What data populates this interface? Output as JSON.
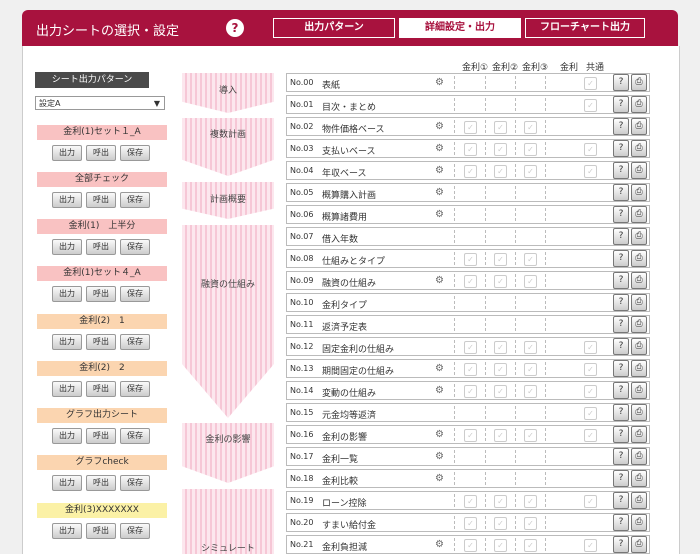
{
  "header": {
    "title": "出力シートの選択・設定",
    "help_icon": "?",
    "tabs": [
      {
        "label": "出力パターン",
        "active": false
      },
      {
        "label": "詳細設定・出力",
        "active": true
      },
      {
        "label": "フローチャート出力",
        "active": false
      }
    ]
  },
  "columns": {
    "kinri1": "金利①",
    "kinri2": "金利②",
    "kinri3": "金利③",
    "kinri": "金利",
    "kyotsu": "共通"
  },
  "left": {
    "title": "シート出力パターン",
    "select_value": "設定A",
    "button_labels": {
      "out": "出力",
      "call": "呼出",
      "save": "保存"
    },
    "sets": [
      {
        "label": "金利(1)セット１_A",
        "color": "#f9c2c2"
      },
      {
        "label": "全部チェック",
        "color": "#f9c2c2"
      },
      {
        "label": "金利(1)　上半分",
        "color": "#f9c2c2"
      },
      {
        "label": "金利(1)セット４_A",
        "color": "#f9c2c2"
      },
      {
        "label": "金利(2)　1",
        "color": "#fbd5b0"
      },
      {
        "label": "金利(2)　2",
        "color": "#fbd5b0"
      },
      {
        "label": "グラフ出力シート",
        "color": "#fbd5b0"
      },
      {
        "label": "グラフcheck",
        "color": "#fbd5b0"
      },
      {
        "label": "金利(3)XXXXXXX",
        "color": "#fbf1a6"
      }
    ]
  },
  "sections": [
    "導入",
    "複数計画",
    "計画概要",
    "融資の仕組み",
    "金利の影響",
    "シミュレート"
  ],
  "rows": [
    {
      "no": "No.00",
      "name": "表紙",
      "gear": true
    },
    {
      "no": "No.01",
      "name": "目次・まとめ",
      "gear": false
    },
    {
      "no": "No.02",
      "name": "物件価格ベース",
      "gear": true
    },
    {
      "no": "No.03",
      "name": "支払いベース",
      "gear": true
    },
    {
      "no": "No.04",
      "name": "年収ベース",
      "gear": true
    },
    {
      "no": "No.05",
      "name": "概算購入計画",
      "gear": true
    },
    {
      "no": "No.06",
      "name": "概算諸費用",
      "gear": true
    },
    {
      "no": "No.07",
      "name": "借入年数",
      "gear": false
    },
    {
      "no": "No.08",
      "name": "仕組みとタイプ",
      "gear": false
    },
    {
      "no": "No.09",
      "name": "融資の仕組み",
      "gear": true
    },
    {
      "no": "No.10",
      "name": "金利タイプ",
      "gear": false
    },
    {
      "no": "No.11",
      "name": "返済予定表",
      "gear": false
    },
    {
      "no": "No.12",
      "name": "固定金利の仕組み",
      "gear": false
    },
    {
      "no": "No.13",
      "name": "期間固定の仕組み",
      "gear": true
    },
    {
      "no": "No.14",
      "name": "変動の仕組み",
      "gear": true
    },
    {
      "no": "No.15",
      "name": "元金均等返済",
      "gear": false
    },
    {
      "no": "No.16",
      "name": "金利の影響",
      "gear": true
    },
    {
      "no": "No.17",
      "name": "金利一覧",
      "gear": true
    },
    {
      "no": "No.18",
      "name": "金利比較",
      "gear": true
    },
    {
      "no": "No.19",
      "name": "ローン控除",
      "gear": false
    },
    {
      "no": "No.20",
      "name": "すまい給付金",
      "gear": false
    },
    {
      "no": "No.21",
      "name": "金利負担減",
      "gear": true
    }
  ],
  "icons": {
    "gear": "gear-icon",
    "help": "help-icon",
    "print": "print-icon"
  },
  "colors": {
    "accent": "#a8123e"
  }
}
